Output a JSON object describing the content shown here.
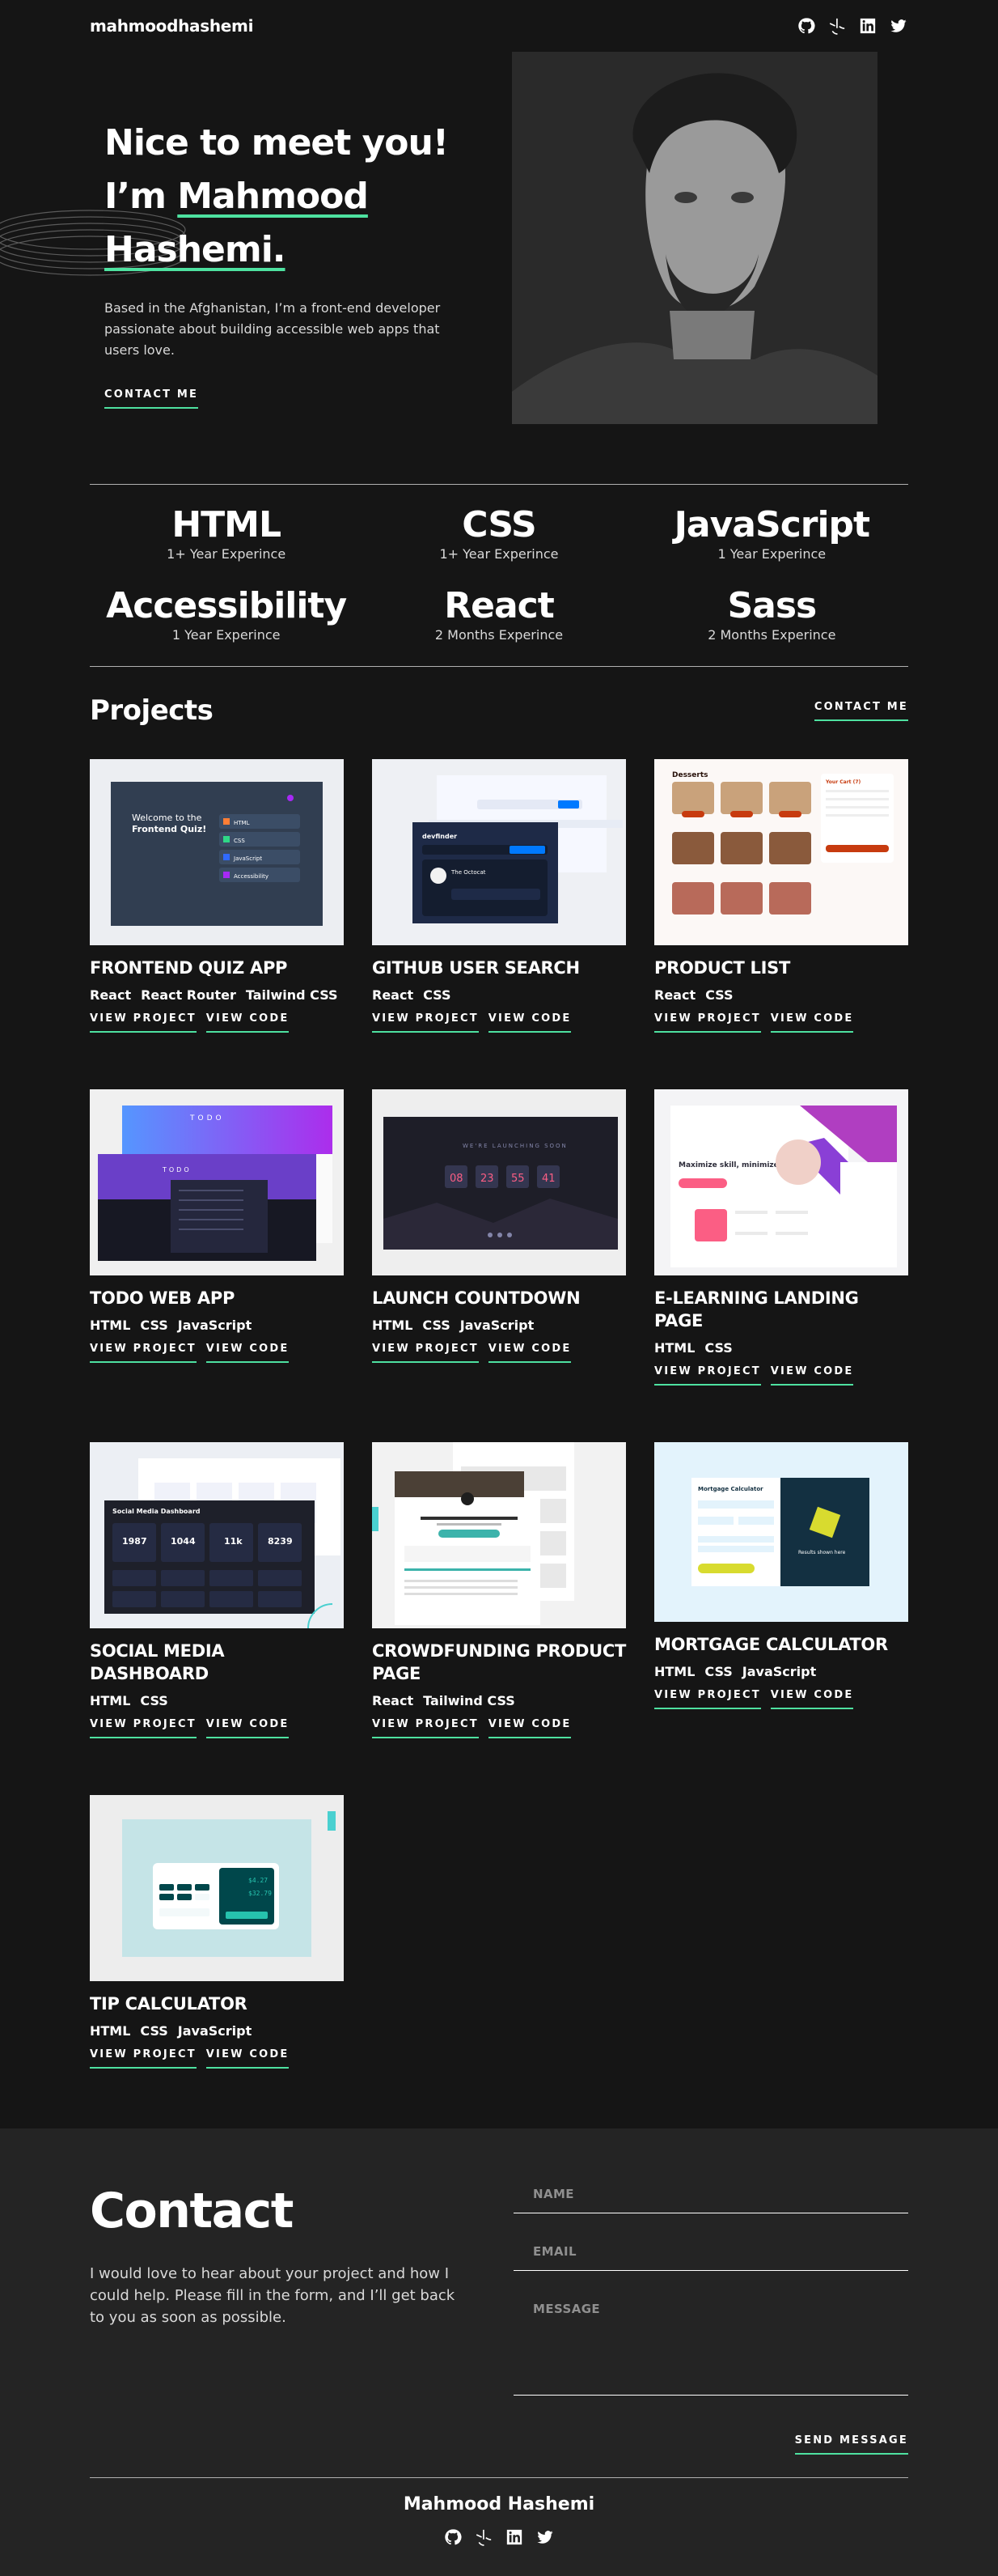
{
  "header": {
    "brand": "mahmoodhashemi",
    "socials": [
      "github-icon",
      "frontend-mentor-icon",
      "linkedin-icon",
      "twitter-icon"
    ]
  },
  "hero": {
    "greeting": "Nice to meet you!",
    "im": "I’m ",
    "name": "Mahmood Hashemi.",
    "description": "Based in the Afghanistan, I’m a front-end developer passionate about building accessible web apps that users love.",
    "cta": "CONTACT ME"
  },
  "skills": [
    {
      "name": "HTML",
      "exp": "1+ Year Experince"
    },
    {
      "name": "CSS",
      "exp": "1+ Year Experince"
    },
    {
      "name": "JavaScript",
      "exp": "1 Year Experince"
    },
    {
      "name": "Accessibility",
      "exp": "1 Year Experince"
    },
    {
      "name": "React",
      "exp": "2 Months Experince"
    },
    {
      "name": "Sass",
      "exp": "2 Months Experince"
    }
  ],
  "projects": {
    "title": "Projects",
    "cta": "CONTACT ME",
    "view_project": "VIEW PROJECT",
    "view_code": "VIEW CODE",
    "items": [
      {
        "title": "FRONTEND QUIZ APP",
        "tags": [
          "React",
          "React Router",
          "Tailwind CSS"
        ]
      },
      {
        "title": "GITHUB USER SEARCH",
        "tags": [
          "React",
          "CSS"
        ]
      },
      {
        "title": "PRODUCT LIST",
        "tags": [
          "React",
          "CSS"
        ]
      },
      {
        "title": "TODO WEB APP",
        "tags": [
          "HTML",
          "CSS",
          "JavaScript"
        ]
      },
      {
        "title": "LAUNCH COUNTDOWN",
        "tags": [
          "HTML",
          "CSS",
          "JavaScript"
        ]
      },
      {
        "title": "E-LEARNING LANDING PAGE",
        "tags": [
          "HTML",
          "CSS"
        ]
      },
      {
        "title": "SOCIAL MEDIA DASHBOARD",
        "tags": [
          "HTML",
          "CSS"
        ]
      },
      {
        "title": "CROWDFUNDING PRODUCT PAGE",
        "tags": [
          "React",
          "Tailwind CSS"
        ]
      },
      {
        "title": "MORTGAGE CALCULATOR",
        "tags": [
          "HTML",
          "CSS",
          "JavaScript"
        ]
      },
      {
        "title": "TIP CALCULATOR",
        "tags": [
          "HTML",
          "CSS",
          "JavaScript"
        ]
      }
    ]
  },
  "thumbs": {
    "quiz": {
      "welcome": "Welcome to the",
      "app": "Frontend Quiz!",
      "options": [
        "HTML",
        "CSS",
        "JavaScript",
        "Accessibility"
      ]
    },
    "countdown": {
      "heading": "WE'RE LAUNCHING SOON",
      "digits": [
        "08",
        "23",
        "55",
        "41"
      ]
    },
    "todo": {
      "heading": "TODO"
    },
    "dashboard": {
      "title": "Social Media Dashboard",
      "numbers": [
        "1987",
        "1044",
        "11k",
        "8239"
      ]
    },
    "product": {
      "heading": "Desserts",
      "cart": "Your Cart (7)"
    },
    "elearning": {
      "headline": "Maximize skill, minimize budget"
    },
    "mortgage": {
      "title": "Mortgage Calculator",
      "result": "Results shown here"
    },
    "tip": {
      "amount": "$4.27",
      "total": "$32.79"
    },
    "github": {
      "title": "devfinder",
      "user": "The Octocat"
    }
  },
  "contact": {
    "title": "Contact",
    "description": "I would love to hear about your project and how I could help. Please fill in the form, and I’ll get back to you as soon as possible.",
    "name_placeholder": "NAME",
    "email_placeholder": "EMAIL",
    "message_placeholder": "MESSAGE",
    "send": "SEND MESSAGE"
  },
  "footer": {
    "name": "Mahmood Hashemi"
  },
  "colors": {
    "accent": "#4ee1a0",
    "background": "#151515",
    "contact_bg": "#242424"
  }
}
